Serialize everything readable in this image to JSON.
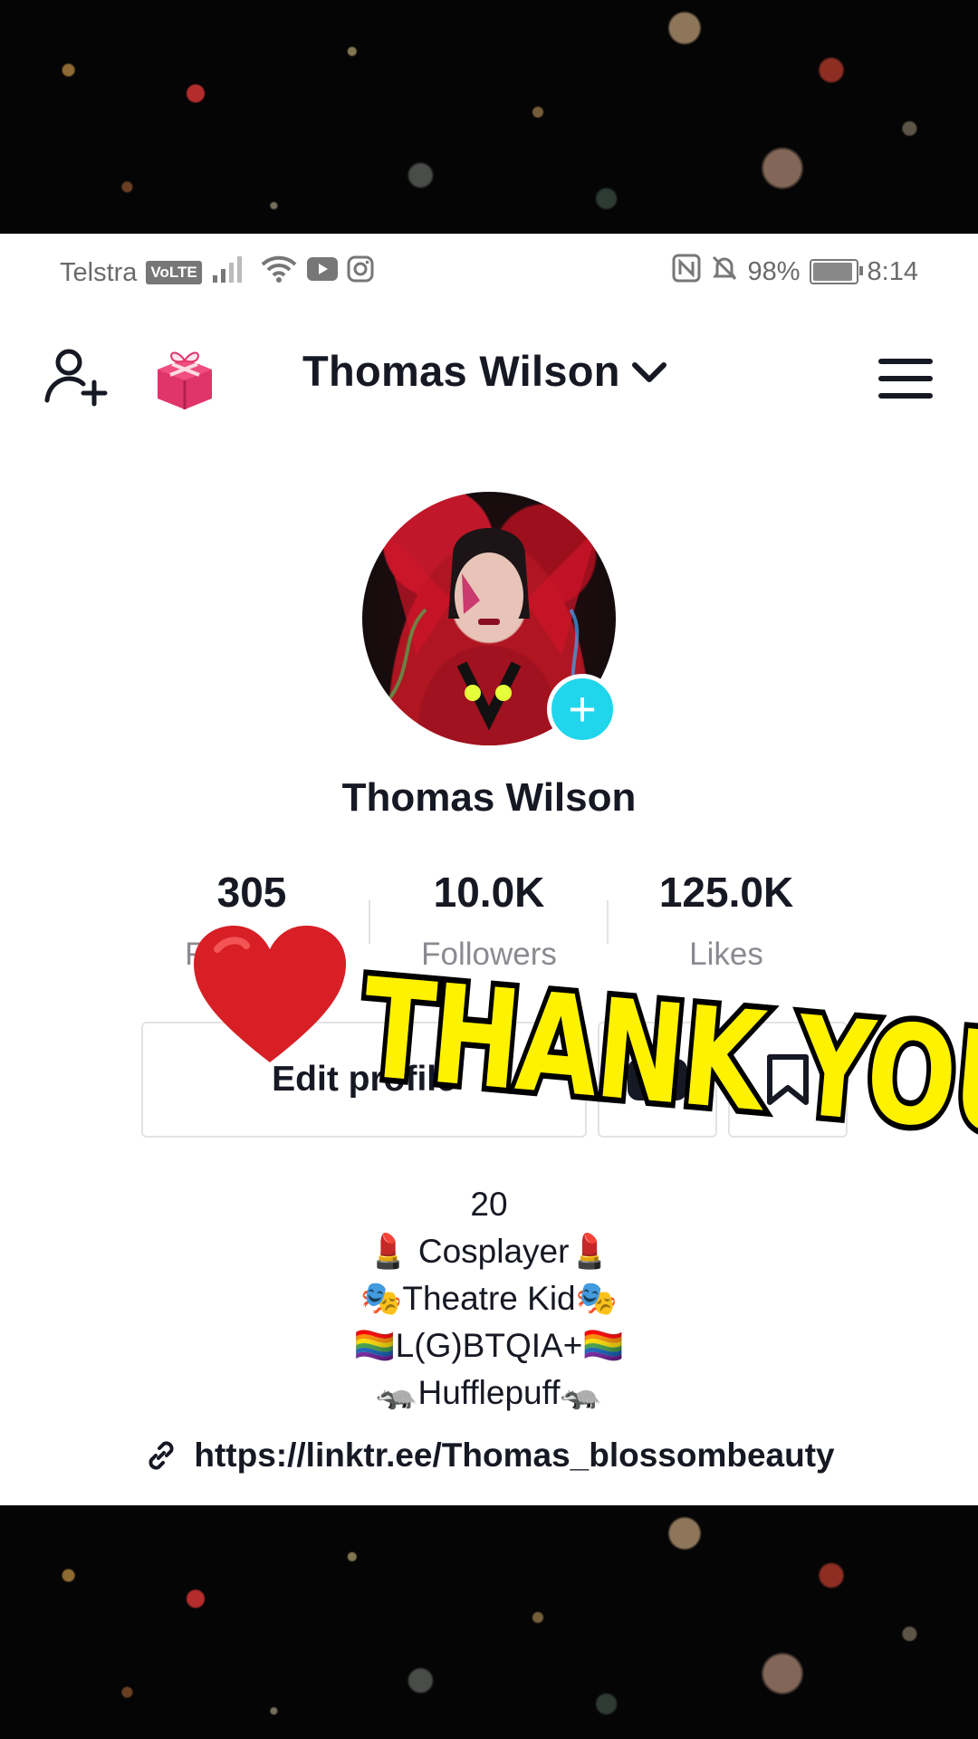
{
  "status_bar": {
    "carrier": "Telstra",
    "volte": "VoLTE",
    "battery": "98%",
    "battery_level": 0.98,
    "time": "8:14"
  },
  "header": {
    "username": "Thomas Wilson",
    "icons": [
      "add-friend-icon",
      "gift-icon",
      "chevron-down-icon",
      "menu-icon"
    ]
  },
  "profile": {
    "display_name": "Thomas Wilson"
  },
  "stats": {
    "following": {
      "value": "305",
      "label": "Following"
    },
    "followers": {
      "value": "10.0K",
      "label": "Followers"
    },
    "likes": {
      "value": "125.0K",
      "label": "Likes"
    }
  },
  "actions": {
    "edit_profile": "Edit profile"
  },
  "bio": {
    "lines": [
      "20",
      "💄 Cosplayer💄",
      "🎭Theatre Kid🎭",
      "🏳️‍🌈L(G)BTQIA+🏳️‍🌈",
      "🦡Hufflepuff🦡"
    ]
  },
  "link": "https://linktr.ee/Thomas_blossombeauty",
  "overlay": {
    "text": "THANK YOU"
  },
  "colors": {
    "accent_cyan": "#20d5ec",
    "gift_pink": "#e0356a",
    "overlay_yellow": "#fff200"
  }
}
